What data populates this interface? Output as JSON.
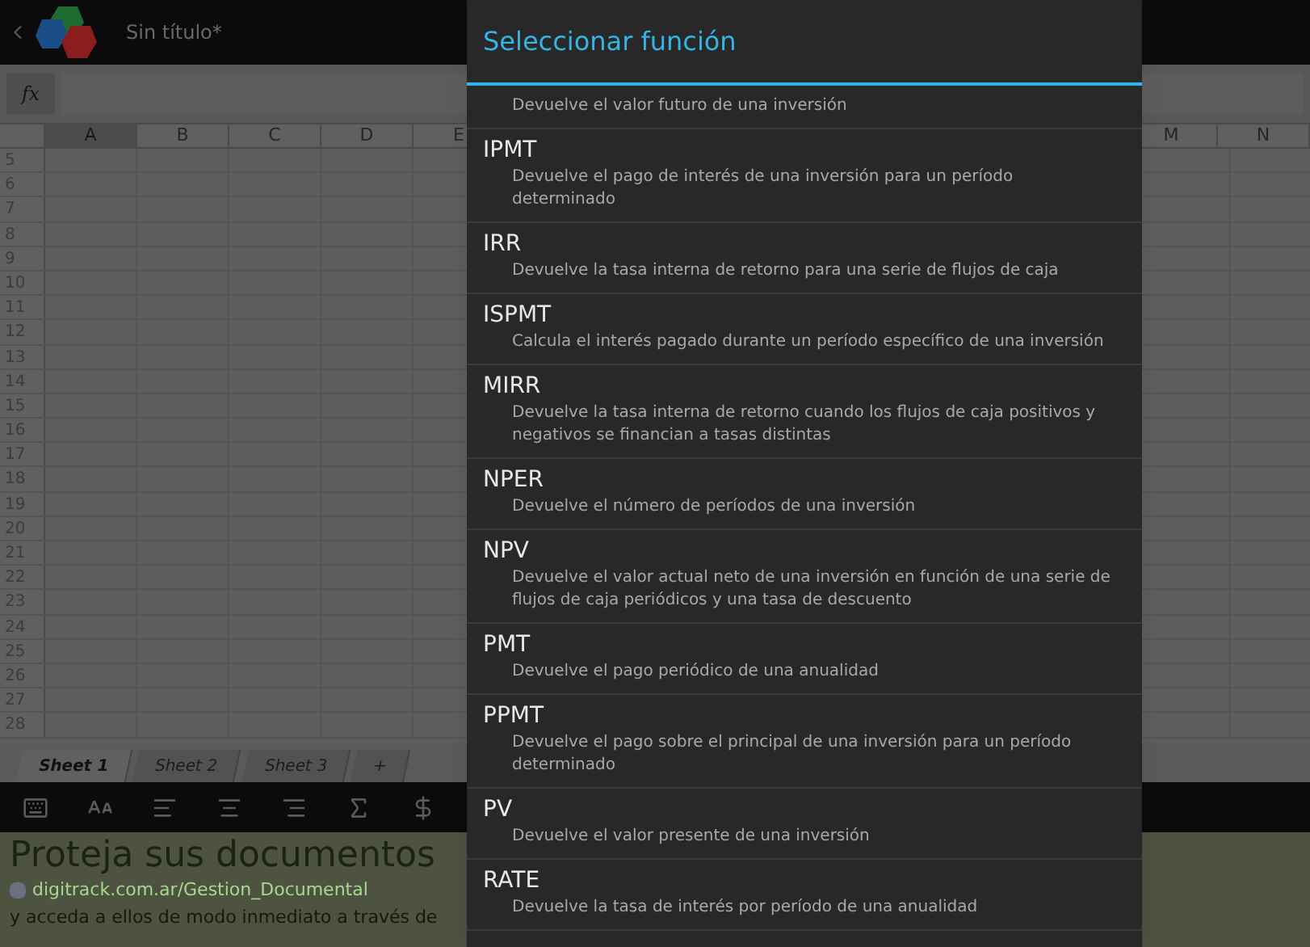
{
  "app_bar": {
    "title": "Sin título*"
  },
  "formula_bar": {
    "label": "fx"
  },
  "sheet": {
    "columns": [
      {
        "label": "A",
        "selected": true
      },
      {
        "label": "B",
        "selected": false
      },
      {
        "label": "C",
        "selected": false
      },
      {
        "label": "D",
        "selected": false
      },
      {
        "label": "E",
        "selected": false
      }
    ],
    "columns_right": [
      {
        "label": "M",
        "selected": false
      },
      {
        "label": "N",
        "selected": false
      }
    ],
    "rows": [
      "5",
      "6",
      "7",
      "8",
      "9",
      "10",
      "11",
      "12",
      "13",
      "14",
      "15",
      "16",
      "17",
      "18",
      "19",
      "20",
      "21",
      "22",
      "23",
      "24",
      "25",
      "26",
      "27",
      "28"
    ]
  },
  "sheet_tabs": [
    {
      "label": "Sheet 1",
      "selected": true
    },
    {
      "label": "Sheet 2",
      "selected": false
    },
    {
      "label": "Sheet 3",
      "selected": false
    },
    {
      "label": "+",
      "selected": false
    }
  ],
  "toolbar": [
    {
      "kind": "keyboard"
    },
    {
      "kind": "font-size"
    },
    {
      "kind": "align-left"
    },
    {
      "kind": "align-center"
    },
    {
      "kind": "align-right"
    },
    {
      "kind": "sum"
    },
    {
      "kind": "currency"
    }
  ],
  "ad": {
    "headline": "Proteja sus documentos",
    "url": "digitrack.com.ar/Gestion_Documental",
    "text": "y acceda a ellos de modo inmediato a través de"
  },
  "dialog": {
    "title": "Seleccionar función",
    "functions": [
      {
        "description": "Devuelve el valor futuro de una inversión"
      },
      {
        "name": "IPMT",
        "description": "Devuelve el pago de interés de una inversión para un período determinado"
      },
      {
        "name": "IRR",
        "description": "Devuelve la tasa interna de retorno para una serie de flujos de caja"
      },
      {
        "name": "ISPMT",
        "description": "Calcula el interés pagado durante un período específico de una inversión"
      },
      {
        "name": "MIRR",
        "description": "Devuelve la tasa interna de retorno cuando los flujos de caja positivos y negativos se financian a tasas distintas"
      },
      {
        "name": "NPER",
        "description": "Devuelve el número de períodos de una inversión"
      },
      {
        "name": "NPV",
        "description": "Devuelve el valor actual neto de una inversión en función de una serie de flujos de caja periódicos y una tasa de descuento"
      },
      {
        "name": "PMT",
        "description": "Devuelve el pago periódico de una anualidad"
      },
      {
        "name": "PPMT",
        "description": "Devuelve el pago sobre el principal de una inversión para un período determinado"
      },
      {
        "name": "PV",
        "description": "Devuelve el valor presente de una inversión"
      },
      {
        "name": "RATE",
        "description": "Devuelve la tasa de interés por período de una anualidad"
      }
    ]
  }
}
